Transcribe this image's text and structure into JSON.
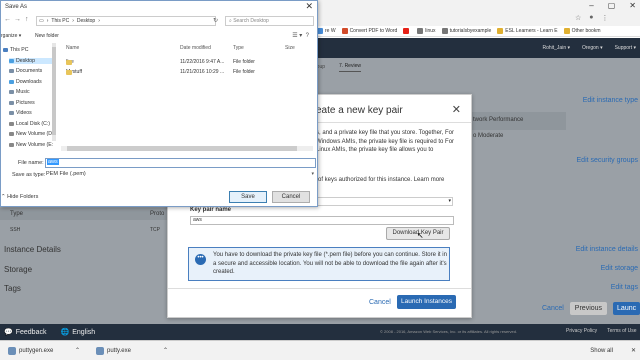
{
  "browser": {
    "window_controls": [
      "–",
      "▢",
      "✕"
    ],
    "bookmarks": [
      {
        "label": "re W",
        "color": "#4a8fdb"
      },
      {
        "label": "Convert PDF to Word",
        "color": "#d24b2a"
      },
      {
        "label": "",
        "color": "#e62117"
      },
      {
        "label": "linux",
        "color": "#777777"
      },
      {
        "label": "tutorialsbyexample",
        "color": "#777777"
      },
      {
        "label": "ESL Learners - Learn E",
        "color": "#e0b030"
      },
      {
        "label": "Other bookm",
        "color": "#e0b030"
      }
    ]
  },
  "aws": {
    "nav": [
      "Rohit_Jain ▾",
      "Oregon ▾",
      "Support ▾"
    ],
    "steps": [
      "roup",
      "7. Review"
    ],
    "edit_instance_type": "Edit instance type",
    "edit_security_groups": "Edit security groups",
    "edit_instance_details": "Edit instance details",
    "edit_storage": "Edit storage",
    "edit_tags": "Edit tags",
    "network_performance_header": "twork Performance",
    "network_performance_value": "o Moderate",
    "sg_table": {
      "columns": [
        "Type",
        "Proto"
      ],
      "row": [
        "SSH",
        "TCP"
      ]
    },
    "sections": [
      "Instance Details",
      "Storage",
      "Tags"
    ],
    "bottom_buttons": {
      "cancel": "Cancel",
      "previous": "Previous",
      "launch": "Launc"
    },
    "footer": {
      "feedback": "Feedback",
      "language": "English",
      "copyright": "© 2008 - 2016, Amazon Web Services, Inc. or its affiliates. All rights reserved.",
      "privacy": "Privacy Policy",
      "terms": "Terms of Use"
    }
  },
  "modal": {
    "title": "eate a new key pair",
    "intro_text": "s, and a private key file that you store. Together, For Windows AMIs, the private key file is required to For Linux AMIs, the private key file allows you to",
    "keys_text": "of keys authorized for this instance. Learn more",
    "kp_name_label": "Key pair name",
    "kp_name_value": "aws",
    "download_button": "Download Key Pair",
    "info_text": "You have to download the private key file (*.pem file) before you can continue. Store it in a secure and accessible location. You will not be able to download the file again after it's created.",
    "cancel": "Cancel",
    "launch": "Launch Instances"
  },
  "save_dialog": {
    "title": "Save As",
    "path": [
      "This PC",
      "Desktop"
    ],
    "search_placeholder": "Search Desktop",
    "organize": "rganize ▾",
    "new_folder": "New folder",
    "tree": [
      {
        "label": "This PC",
        "color": "#4a7fc0"
      },
      {
        "label": "Desktop",
        "color": "#4a9fe0",
        "selected": true
      },
      {
        "label": "Documents",
        "color": "#7a8fa6"
      },
      {
        "label": "Downloads",
        "color": "#4a9fe0"
      },
      {
        "label": "Music",
        "color": "#7a8fa6"
      },
      {
        "label": "Pictures",
        "color": "#7a8fa6"
      },
      {
        "label": "Videos",
        "color": "#7a8fa6"
      },
      {
        "label": "Local Disk (C:)",
        "color": "#888888"
      },
      {
        "label": "New Volume (D:",
        "color": "#888888"
      },
      {
        "label": "New Volume (E:",
        "color": "#888888"
      }
    ],
    "columns": [
      "Name",
      "Date modified",
      "Type",
      "Size"
    ],
    "files": [
      {
        "name": "five",
        "date": "11/22/2016 9:47 A...",
        "type": "File folder"
      },
      {
        "name": "Mystuff",
        "date": "11/21/2016 10:29 ...",
        "type": "File folder"
      }
    ],
    "file_name_label": "File name:",
    "file_name_value": "aws",
    "save_type_label": "Save as type:",
    "save_type_value": "PEM File (.pem)",
    "hide_folders": "Hide Folders",
    "save": "Save",
    "cancel": "Cancel"
  },
  "taskbar": {
    "items": [
      {
        "label": "puttygen.exe",
        "color": "#6b8fb8"
      },
      {
        "label": "putty.exe",
        "color": "#6b8fb8"
      }
    ],
    "show_all": "Show all"
  }
}
